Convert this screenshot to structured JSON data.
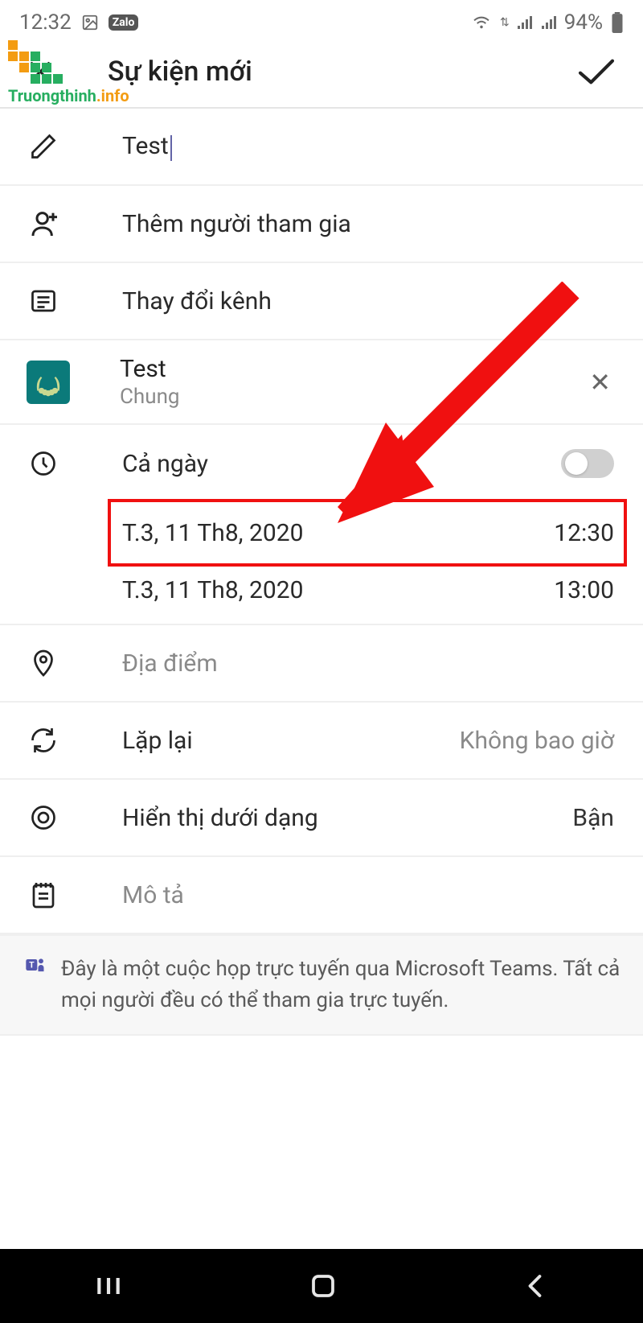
{
  "status_bar": {
    "time": "12:32",
    "battery": "94%"
  },
  "watermark": {
    "text_full": "Truongthinh.info"
  },
  "header": {
    "title": "Sự kiện mới"
  },
  "title_row": {
    "value": "Test"
  },
  "add_participants": {
    "label": "Thêm người tham gia"
  },
  "change_channel": {
    "label": "Thay đổi kênh"
  },
  "team": {
    "name": "Test",
    "sub": "Chung"
  },
  "all_day": {
    "label": "Cả ngày",
    "enabled": false
  },
  "start": {
    "date": "T.3, 11 Th8, 2020",
    "time": "12:30"
  },
  "end": {
    "date": "T.3, 11 Th8, 2020",
    "time": "13:00"
  },
  "location": {
    "label": "Địa điểm"
  },
  "repeat": {
    "label": "Lặp lại",
    "value": "Không bao giờ"
  },
  "show_as": {
    "label": "Hiển thị dưới dạng",
    "value": "Bận"
  },
  "description": {
    "label": "Mô tả"
  },
  "teams_note": {
    "text": "Đây là một cuộc họp trực tuyến qua Microsoft Teams. Tất cả mọi người đều có thể tham gia trực tuyến."
  }
}
